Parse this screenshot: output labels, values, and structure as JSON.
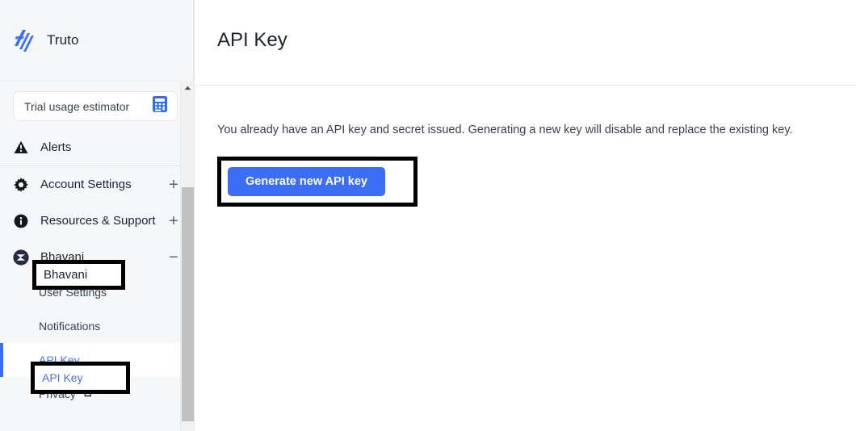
{
  "brand": {
    "name": "Truto",
    "logo_icon": "truto-logo-icon"
  },
  "sidebar": {
    "trial_card": {
      "label": "Trial usage estimator",
      "icon": "calculator-icon"
    },
    "items": [
      {
        "label": "Alerts",
        "icon": "alert-triangle-icon",
        "expander": ""
      },
      {
        "label": "Account Settings",
        "icon": "gear-icon",
        "expander": "+"
      },
      {
        "label": "Resources & Support",
        "icon": "info-icon",
        "expander": "+"
      },
      {
        "label": "Bhavani",
        "icon": "user-avatar-icon",
        "expander": "−"
      }
    ],
    "sub_items": [
      {
        "label": "User Settings",
        "icon": "",
        "active": false
      },
      {
        "label": "Notifications",
        "icon": "",
        "active": false
      },
      {
        "label": "API Key",
        "icon": "",
        "active": true
      },
      {
        "label": "Privacy",
        "icon": "external-link-icon",
        "active": false
      }
    ],
    "scrollbar": {
      "up_arrow_icon": "chevron-up-icon"
    }
  },
  "main": {
    "title": "API Key",
    "description": "You already have an API key and secret issued. Generating a new key will disable and replace the existing key.",
    "generate_button": "Generate new API key"
  },
  "annotations": {
    "bhavani_label": "Bhavani",
    "api_key_label": "API Key"
  },
  "colors": {
    "accent_blue": "#3b6ef5",
    "sidebar_bg": "#f6f7f9",
    "text_dark": "#1b2233",
    "annotation": "#000000"
  }
}
